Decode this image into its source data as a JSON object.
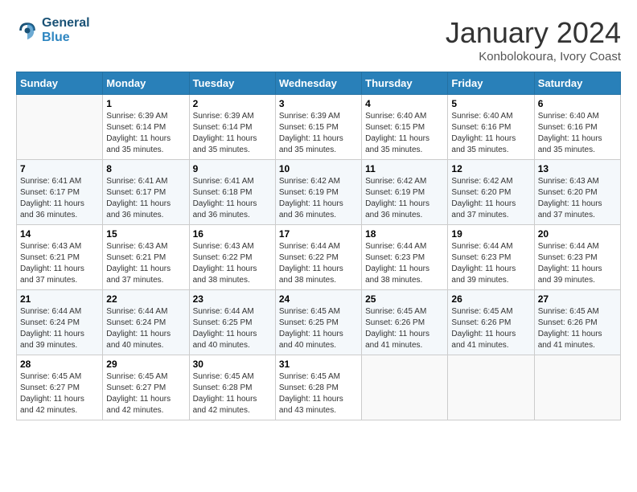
{
  "header": {
    "logo_line1": "General",
    "logo_line2": "Blue",
    "title": "January 2024",
    "subtitle": "Konbolokoura, Ivory Coast"
  },
  "days_of_week": [
    "Sunday",
    "Monday",
    "Tuesday",
    "Wednesday",
    "Thursday",
    "Friday",
    "Saturday"
  ],
  "weeks": [
    [
      {
        "day": "",
        "info": ""
      },
      {
        "day": "1",
        "info": "Sunrise: 6:39 AM\nSunset: 6:14 PM\nDaylight: 11 hours\nand 35 minutes."
      },
      {
        "day": "2",
        "info": "Sunrise: 6:39 AM\nSunset: 6:14 PM\nDaylight: 11 hours\nand 35 minutes."
      },
      {
        "day": "3",
        "info": "Sunrise: 6:39 AM\nSunset: 6:15 PM\nDaylight: 11 hours\nand 35 minutes."
      },
      {
        "day": "4",
        "info": "Sunrise: 6:40 AM\nSunset: 6:15 PM\nDaylight: 11 hours\nand 35 minutes."
      },
      {
        "day": "5",
        "info": "Sunrise: 6:40 AM\nSunset: 6:16 PM\nDaylight: 11 hours\nand 35 minutes."
      },
      {
        "day": "6",
        "info": "Sunrise: 6:40 AM\nSunset: 6:16 PM\nDaylight: 11 hours\nand 35 minutes."
      }
    ],
    [
      {
        "day": "7",
        "info": "Sunrise: 6:41 AM\nSunset: 6:17 PM\nDaylight: 11 hours\nand 36 minutes."
      },
      {
        "day": "8",
        "info": "Sunrise: 6:41 AM\nSunset: 6:17 PM\nDaylight: 11 hours\nand 36 minutes."
      },
      {
        "day": "9",
        "info": "Sunrise: 6:41 AM\nSunset: 6:18 PM\nDaylight: 11 hours\nand 36 minutes."
      },
      {
        "day": "10",
        "info": "Sunrise: 6:42 AM\nSunset: 6:19 PM\nDaylight: 11 hours\nand 36 minutes."
      },
      {
        "day": "11",
        "info": "Sunrise: 6:42 AM\nSunset: 6:19 PM\nDaylight: 11 hours\nand 36 minutes."
      },
      {
        "day": "12",
        "info": "Sunrise: 6:42 AM\nSunset: 6:20 PM\nDaylight: 11 hours\nand 37 minutes."
      },
      {
        "day": "13",
        "info": "Sunrise: 6:43 AM\nSunset: 6:20 PM\nDaylight: 11 hours\nand 37 minutes."
      }
    ],
    [
      {
        "day": "14",
        "info": "Sunrise: 6:43 AM\nSunset: 6:21 PM\nDaylight: 11 hours\nand 37 minutes."
      },
      {
        "day": "15",
        "info": "Sunrise: 6:43 AM\nSunset: 6:21 PM\nDaylight: 11 hours\nand 37 minutes."
      },
      {
        "day": "16",
        "info": "Sunrise: 6:43 AM\nSunset: 6:22 PM\nDaylight: 11 hours\nand 38 minutes."
      },
      {
        "day": "17",
        "info": "Sunrise: 6:44 AM\nSunset: 6:22 PM\nDaylight: 11 hours\nand 38 minutes."
      },
      {
        "day": "18",
        "info": "Sunrise: 6:44 AM\nSunset: 6:23 PM\nDaylight: 11 hours\nand 38 minutes."
      },
      {
        "day": "19",
        "info": "Sunrise: 6:44 AM\nSunset: 6:23 PM\nDaylight: 11 hours\nand 39 minutes."
      },
      {
        "day": "20",
        "info": "Sunrise: 6:44 AM\nSunset: 6:23 PM\nDaylight: 11 hours\nand 39 minutes."
      }
    ],
    [
      {
        "day": "21",
        "info": "Sunrise: 6:44 AM\nSunset: 6:24 PM\nDaylight: 11 hours\nand 39 minutes."
      },
      {
        "day": "22",
        "info": "Sunrise: 6:44 AM\nSunset: 6:24 PM\nDaylight: 11 hours\nand 40 minutes."
      },
      {
        "day": "23",
        "info": "Sunrise: 6:44 AM\nSunset: 6:25 PM\nDaylight: 11 hours\nand 40 minutes."
      },
      {
        "day": "24",
        "info": "Sunrise: 6:45 AM\nSunset: 6:25 PM\nDaylight: 11 hours\nand 40 minutes."
      },
      {
        "day": "25",
        "info": "Sunrise: 6:45 AM\nSunset: 6:26 PM\nDaylight: 11 hours\nand 41 minutes."
      },
      {
        "day": "26",
        "info": "Sunrise: 6:45 AM\nSunset: 6:26 PM\nDaylight: 11 hours\nand 41 minutes."
      },
      {
        "day": "27",
        "info": "Sunrise: 6:45 AM\nSunset: 6:26 PM\nDaylight: 11 hours\nand 41 minutes."
      }
    ],
    [
      {
        "day": "28",
        "info": "Sunrise: 6:45 AM\nSunset: 6:27 PM\nDaylight: 11 hours\nand 42 minutes."
      },
      {
        "day": "29",
        "info": "Sunrise: 6:45 AM\nSunset: 6:27 PM\nDaylight: 11 hours\nand 42 minutes."
      },
      {
        "day": "30",
        "info": "Sunrise: 6:45 AM\nSunset: 6:28 PM\nDaylight: 11 hours\nand 42 minutes."
      },
      {
        "day": "31",
        "info": "Sunrise: 6:45 AM\nSunset: 6:28 PM\nDaylight: 11 hours\nand 43 minutes."
      },
      {
        "day": "",
        "info": ""
      },
      {
        "day": "",
        "info": ""
      },
      {
        "day": "",
        "info": ""
      }
    ]
  ]
}
